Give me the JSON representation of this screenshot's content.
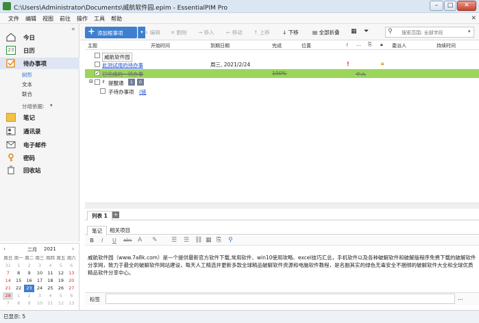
{
  "window": {
    "title": "C:\\Users\\Administrator\\Documents\\威航软件园.epim - EssentialPIM Pro",
    "min": "–",
    "max": "□",
    "close": "✕"
  },
  "menu": [
    "文件",
    "编辑",
    "视图",
    "前往",
    "操作",
    "工具",
    "帮助"
  ],
  "menu_close": "✕",
  "sidebar": {
    "collapse": "«",
    "items": [
      {
        "label": "今日",
        "icon": "home-icon"
      },
      {
        "label": "日历",
        "icon": "calendar-icon",
        "badge": "23"
      },
      {
        "label": "待办事项",
        "icon": "todo-icon"
      },
      {
        "label": "笔记",
        "icon": "note-icon"
      },
      {
        "label": "通讯录",
        "icon": "contacts-icon"
      },
      {
        "label": "电子邮件",
        "icon": "mail-icon"
      },
      {
        "label": "密码",
        "icon": "key-icon"
      },
      {
        "label": "回收站",
        "icon": "trash-icon"
      }
    ],
    "views": [
      "树形",
      "文本",
      "联合"
    ],
    "group_by": "分组依据:",
    "group_arrow": "▾"
  },
  "calendar": {
    "prev": "‹",
    "next": "›",
    "month": "二月",
    "year": "2021",
    "weekdays": [
      "周日",
      "周一",
      "周二",
      "周三",
      "周四",
      "周五",
      "周六"
    ],
    "days": [
      "31",
      "1",
      "2",
      "3",
      "4",
      "5",
      "6",
      "7",
      "8",
      "9",
      "10",
      "11",
      "12",
      "13",
      "14",
      "15",
      "16",
      "17",
      "18",
      "19",
      "20",
      "21",
      "22",
      "23",
      "24",
      "25",
      "26",
      "27",
      "28",
      "1",
      "2",
      "3",
      "4",
      "5",
      "6",
      "7",
      "8",
      "9",
      "10",
      "11",
      "12",
      "13"
    ]
  },
  "toolbar": {
    "add": "添加根事项",
    "add_arrow": "▾",
    "edit": "编辑",
    "delete": "删除",
    "indent": "移入",
    "outdent": "移动",
    "up": "上移",
    "down": "下移",
    "collapse_all": "全部折叠",
    "search_placeholder": "搜索范围: 全部字段",
    "search_more": "▾"
  },
  "columns": [
    "主题",
    "开始时间",
    "到期日期",
    "完成",
    "位置",
    "!",
    "",
    "",
    "",
    "委派人",
    "持续时间"
  ],
  "tasks": [
    {
      "subject": "威航软件园",
      "due": "",
      "complete": ""
    },
    {
      "subject": "此测试用的待办事",
      "due": "周三, 2021/2/24",
      "complete": ""
    },
    {
      "subject": "已完成的一待办事",
      "due": "",
      "complete": "100%",
      "delegate": "个人"
    },
    {
      "subject": "提醒通",
      "badge1": "1",
      "badge2": "0"
    },
    {
      "subject": "子待办事项",
      "link": "(链"
    }
  ],
  "list_tab": "列表 1",
  "list_add": "+",
  "detail_tabs": [
    "笔记",
    "相关项目"
  ],
  "format_buttons": [
    "B",
    "I",
    "U",
    "abc",
    "A",
    "✎"
  ],
  "note_text": "威航软件园（www.7a8k.com）是一个提供最新官方软件下载,常用软件、win10使用攻略、excel技巧汇总，手机软件以及各种破解软件和破解版程序免费下载的破解软件分享网，致力于最全的破解软件网站建设，每天人工精选并更新多款全球精品破解软件资源和电脑软件教程，是名副其实的绿色无毒安全不捆绑的破解软件大全和全球优质精品软件分享中心。",
  "tag_label": "标签",
  "tag_more": "...",
  "status": "已显示: 5",
  "colors": {
    "accent": "#3e7fcf",
    "completed_row": "#9bd65a",
    "priority": "#e02020"
  }
}
